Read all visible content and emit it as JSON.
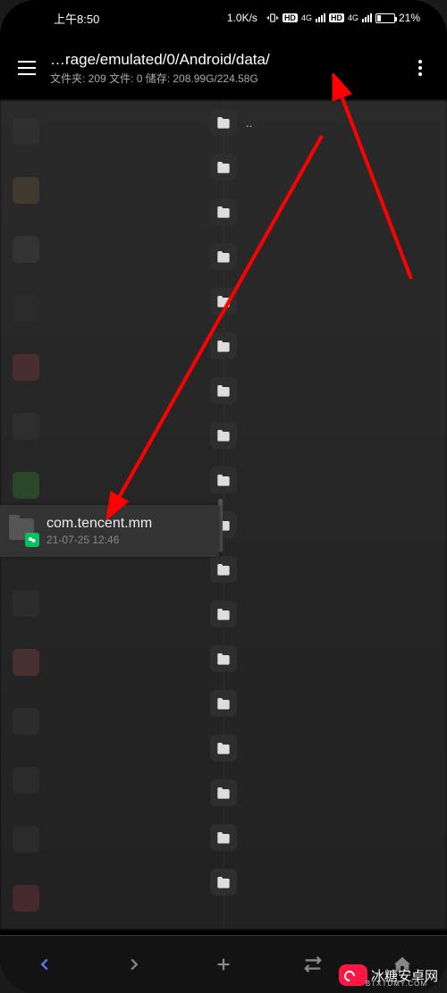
{
  "status": {
    "time": "上午8:50",
    "speed": "1.0K/s",
    "net1": "HD",
    "net1_type": "4G",
    "net2": "HD",
    "net2_type": "4G",
    "battery_pct": "21%"
  },
  "header": {
    "path": "…rage/emulated/0/Android/data/",
    "stats": "文件夹: 209  文件: 0  储存: 208.99G/224.58G"
  },
  "folders": {
    "up_label": "..",
    "count": 18
  },
  "highlight": {
    "name": "com.tencent.mm",
    "date": "21-07-25 12:46"
  },
  "watermark": {
    "text": "冰糖安卓网",
    "sub": "BTXTDMY.COM"
  }
}
